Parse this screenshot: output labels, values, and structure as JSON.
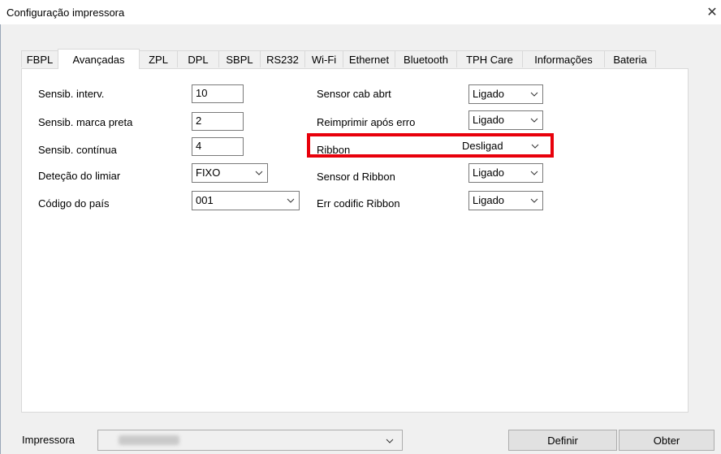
{
  "window": {
    "title": "Configuração impressora"
  },
  "tabs": [
    {
      "label": "FBPL",
      "active": false
    },
    {
      "label": "Avançadas",
      "active": true
    },
    {
      "label": "ZPL",
      "active": false
    },
    {
      "label": "DPL",
      "active": false
    },
    {
      "label": "SBPL",
      "active": false
    },
    {
      "label": "RS232",
      "active": false
    },
    {
      "label": "Wi-Fi",
      "active": false
    },
    {
      "label": "Ethernet",
      "active": false
    },
    {
      "label": "Bluetooth",
      "active": false
    },
    {
      "label": "TPH Care",
      "active": false
    },
    {
      "label": "Informações",
      "active": false
    },
    {
      "label": "Bateria",
      "active": false
    }
  ],
  "left_fields": {
    "sensib_interv": {
      "label": "Sensib. interv.",
      "value": "10"
    },
    "sensib_marca": {
      "label": "Sensib. marca preta",
      "value": "2"
    },
    "sensib_continua": {
      "label": "Sensib. contínua",
      "value": "4"
    },
    "detecao_limiar": {
      "label": "Deteção do limiar",
      "value": "FIXO"
    },
    "codigo_pais": {
      "label": "Código do país",
      "value": "001"
    }
  },
  "right_fields": {
    "sensor_cab": {
      "label": "Sensor cab abrt",
      "value": "Ligado"
    },
    "reimprimir": {
      "label": "Reimprimir após erro",
      "value": "Ligado"
    },
    "ribbon": {
      "label": "Ribbon",
      "value": "Desligad"
    },
    "sensor_ribbon": {
      "label": "Sensor d Ribbon",
      "value": "Ligado"
    },
    "err_codific": {
      "label": "Err codific Ribbon",
      "value": "Ligado"
    }
  },
  "bottom": {
    "printer_label": "Impressora",
    "define_button": "Definir",
    "get_button": "Obter"
  },
  "colors": {
    "highlight": "#e8000b"
  }
}
